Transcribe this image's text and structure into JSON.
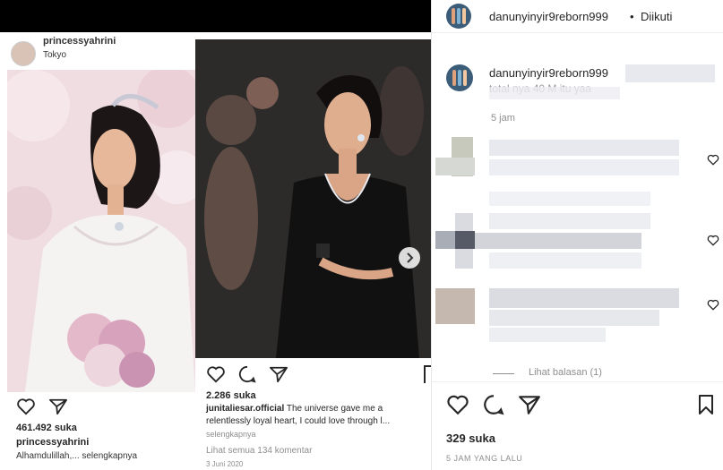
{
  "left_post": {
    "username": "princessyahrini",
    "location": "Tokyo",
    "likes": "461.492 suka",
    "caption_user": "princessyahrini",
    "caption_text": "Alhamdulillah,... selengkapnya"
  },
  "right_post": {
    "likes": "2.286 suka",
    "caption_user": "junitaliesar.official",
    "caption_line1": "The universe gave me a",
    "caption_line2": "relentlessly loyal heart, I could love through l...",
    "more": "selengkapnya",
    "comments": "Lihat semua 134 komentar",
    "date": "3 Juni 2020"
  },
  "header": {
    "username": "danunyinyir9reborn999",
    "dot": "•",
    "follow": "Diikuti"
  },
  "comment": {
    "username": "danunyinyir9reborn999",
    "text": "total nya 40 M itu yaa",
    "time": "5 jam"
  },
  "replies": {
    "view_label": "Lihat balasan (1)"
  },
  "actions": {
    "likes": "329 suka",
    "time": "5 JAM YANG LALU"
  },
  "icons": [
    "heart-icon",
    "comment-icon",
    "share-icon",
    "bookmark-icon",
    "chevron-right-icon"
  ],
  "colors": {
    "text": "#262626",
    "muted": "#8e8e8e",
    "border": "#dbdbdb",
    "dress": "#111111"
  }
}
